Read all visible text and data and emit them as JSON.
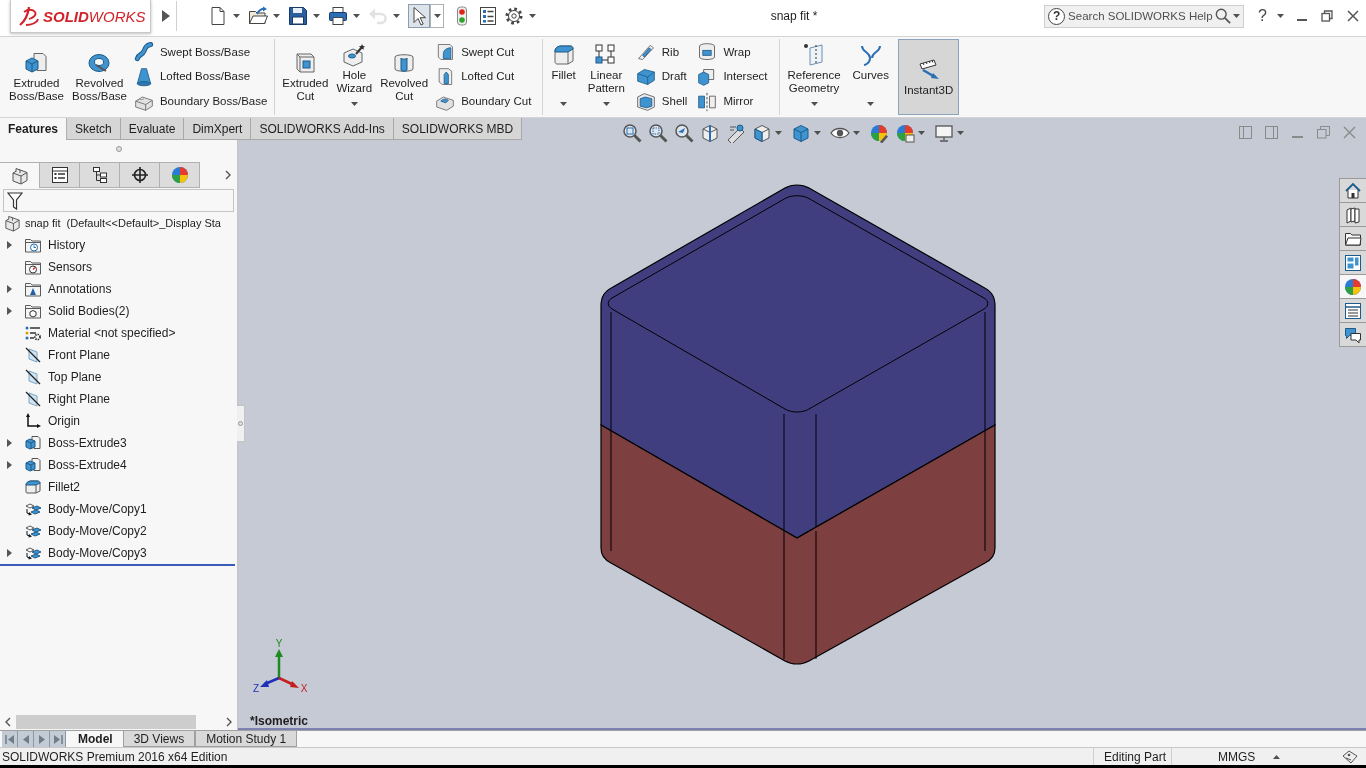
{
  "title_bar": {
    "logo": "**SOLID**WORKS",
    "title": "snap fit *",
    "search": {
      "help_mark": "?",
      "placeholder": "Search SOLIDWORKS Help"
    },
    "help": "?"
  },
  "quick_access": [
    {
      "kind": "new",
      "menu": true,
      "disabled": false,
      "pressed": false
    },
    {
      "kind": "open",
      "menu": true,
      "disabled": false,
      "pressed": false
    },
    {
      "kind": "save",
      "menu": true,
      "disabled": false,
      "pressed": false
    },
    {
      "kind": "print",
      "menu": true,
      "disabled": false,
      "pressed": false
    },
    {
      "kind": "undo",
      "menu": true,
      "disabled": true,
      "pressed": false
    },
    {
      "kind": "select",
      "menu": true,
      "disabled": false,
      "pressed": true
    },
    {
      "kind": "rebuild",
      "menu": false,
      "disabled": false,
      "pressed": false
    },
    {
      "kind": "file-properties",
      "menu": false,
      "disabled": false,
      "pressed": false
    },
    {
      "kind": "options",
      "menu": true,
      "disabled": false,
      "pressed": false
    }
  ],
  "ribbon": {
    "groups": [
      {
        "large": [
          {
            "kind": "extruded-boss",
            "label": "Extruded Boss/Base",
            "menu": false,
            "on": false
          },
          {
            "kind": "revolved-boss",
            "label": "Revolved Boss/Base",
            "menu": false,
            "on": false
          }
        ],
        "small_columns": [
          [
            {
              "kind": "swept-boss",
              "label": "Swept Boss/Base"
            },
            {
              "kind": "lofted-boss",
              "label": "Lofted Boss/Base"
            },
            {
              "kind": "boundary-boss",
              "label": "Boundary Boss/Base"
            }
          ]
        ]
      },
      {
        "large": [
          {
            "kind": "extruded-cut",
            "label": "Extruded Cut",
            "menu": false,
            "on": false
          },
          {
            "kind": "hole-wizard",
            "label": "Hole Wizard",
            "menu": true,
            "on": false
          },
          {
            "kind": "revolved-cut",
            "label": "Revolved Cut",
            "menu": false,
            "on": false
          }
        ],
        "small_columns": [
          [
            {
              "kind": "swept-cut",
              "label": "Swept Cut"
            },
            {
              "kind": "lofted-cut",
              "label": "Lofted Cut"
            },
            {
              "kind": "boundary-cut",
              "label": "Boundary Cut"
            }
          ]
        ]
      },
      {
        "large": [
          {
            "kind": "fillet",
            "label": "Fillet",
            "menu": true,
            "on": false
          },
          {
            "kind": "linear-pattern",
            "label": "Linear Pattern",
            "menu": true,
            "on": false
          }
        ],
        "small_columns": [
          [
            {
              "kind": "rib",
              "label": "Rib"
            },
            {
              "kind": "draft",
              "label": "Draft"
            },
            {
              "kind": "shell",
              "label": "Shell"
            }
          ],
          [
            {
              "kind": "wrap",
              "label": "Wrap"
            },
            {
              "kind": "intersect",
              "label": "Intersect"
            },
            {
              "kind": "mirror",
              "label": "Mirror"
            }
          ]
        ]
      },
      {
        "large": [
          {
            "kind": "reference-geometry",
            "label": "Reference Geometry",
            "menu": true,
            "on": false
          },
          {
            "kind": "curves",
            "label": "Curves",
            "menu": true,
            "on": false
          },
          {
            "kind": "instant3d",
            "label": "Instant3D",
            "menu": false,
            "on": true
          }
        ]
      }
    ]
  },
  "command_tabs": [
    {
      "label": "Features",
      "selected": true
    },
    {
      "label": "Sketch",
      "selected": false
    },
    {
      "label": "Evaluate",
      "selected": false
    },
    {
      "label": "DimXpert",
      "selected": false
    },
    {
      "label": "SOLIDWORKS Add-Ins",
      "selected": false
    },
    {
      "label": "SOLIDWORKS MBD",
      "selected": false
    }
  ],
  "feature_manager": {
    "tabs": [
      {
        "kind": "feature-tree",
        "selected": true
      },
      {
        "kind": "property-manager",
        "selected": false
      },
      {
        "kind": "configuration-manager",
        "selected": false
      },
      {
        "kind": "dimxpert-manager",
        "selected": false
      },
      {
        "kind": "display-manager",
        "selected": false
      }
    ],
    "root": "snap fit  (Default<<Default>_Display Sta",
    "items": [
      {
        "label": "History",
        "kind": "history",
        "expandable": true
      },
      {
        "label": "Sensors",
        "kind": "sensors",
        "expandable": false
      },
      {
        "label": "Annotations",
        "kind": "annotations",
        "expandable": true
      },
      {
        "label": "Solid Bodies(2)",
        "kind": "bodies",
        "expandable": true
      },
      {
        "label": "Material <not specified>",
        "kind": "material",
        "expandable": false
      },
      {
        "label": "Front Plane",
        "kind": "plane",
        "expandable": false
      },
      {
        "label": "Top Plane",
        "kind": "plane",
        "expandable": false
      },
      {
        "label": "Right Plane",
        "kind": "plane",
        "expandable": false
      },
      {
        "label": "Origin",
        "kind": "origin",
        "expandable": false
      },
      {
        "label": "Boss-Extrude3",
        "kind": "extrude",
        "expandable": true
      },
      {
        "label": "Boss-Extrude4",
        "kind": "extrude",
        "expandable": true
      },
      {
        "label": "Fillet2",
        "kind": "fillet",
        "expandable": false
      },
      {
        "label": "Body-Move/Copy1",
        "kind": "move-copy",
        "expandable": false
      },
      {
        "label": "Body-Move/Copy2",
        "kind": "move-copy",
        "expandable": false
      },
      {
        "label": "Body-Move/Copy3",
        "kind": "move-copy",
        "expandable": true
      }
    ]
  },
  "graphics": {
    "triad": {
      "x": "X",
      "y": "Y",
      "z": "Z"
    },
    "view_name": "*Isometric",
    "task_pane": [
      {
        "kind": "home",
        "selected": false
      },
      {
        "kind": "design-library",
        "selected": false
      },
      {
        "kind": "file-explorer",
        "selected": false
      },
      {
        "kind": "view-palette",
        "selected": false
      },
      {
        "kind": "appearances",
        "selected": true
      },
      {
        "kind": "custom-properties",
        "selected": false
      },
      {
        "kind": "forum",
        "selected": false
      }
    ]
  },
  "bottom_tabs": [
    {
      "label": "Model",
      "selected": true
    },
    {
      "label": "3D Views",
      "selected": false
    },
    {
      "label": "Motion Study 1",
      "selected": false
    }
  ],
  "status_bar": {
    "product": "SOLIDWORKS Premium 2016 x64 Edition",
    "mode": "Editing Part",
    "units": "MMGS"
  }
}
